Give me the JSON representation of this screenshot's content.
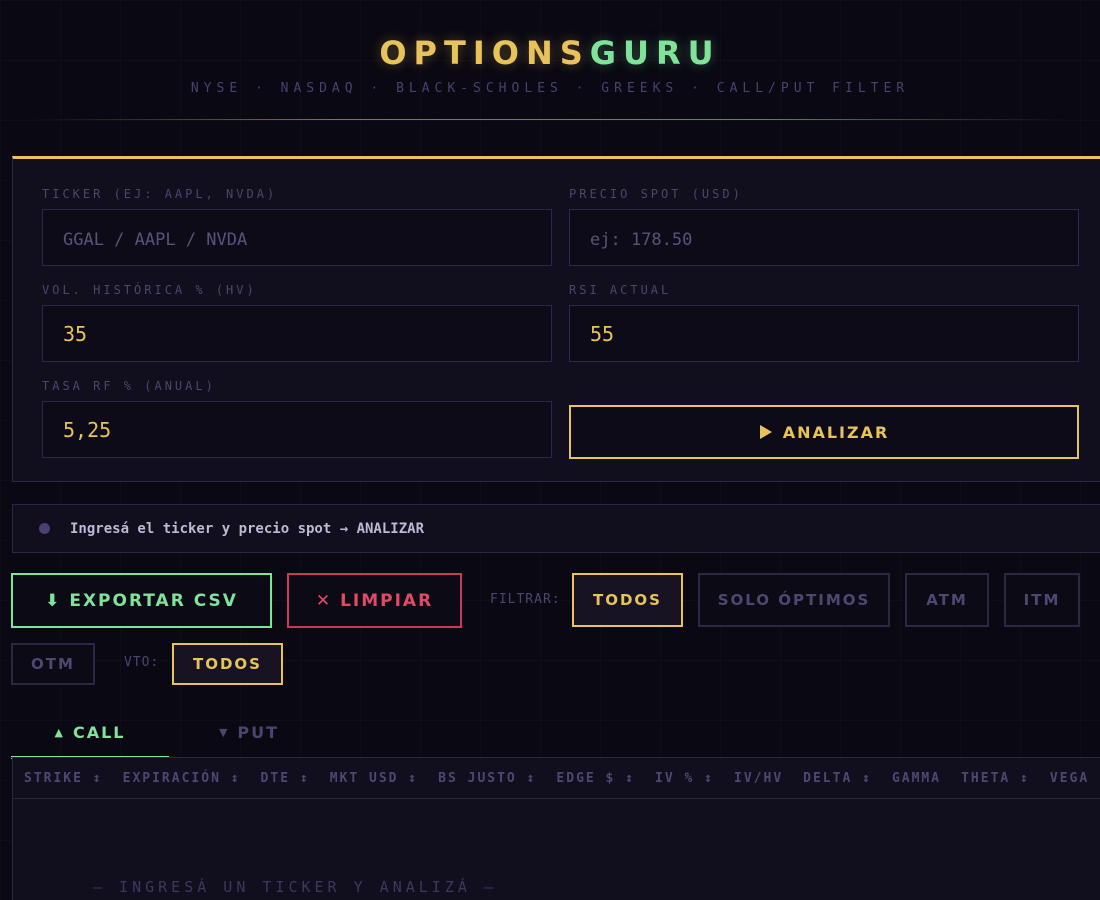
{
  "header": {
    "logo_part1": "OPTIONS",
    "logo_part2": "GURU",
    "subtitle": "NYSE · NASDAQ · BLACK-SCHOLES · GREEKS · CALL/PUT FILTER"
  },
  "form": {
    "ticker": {
      "label": "TICKER (EJ: AAPL, NVDA)",
      "placeholder": "GGAL / AAPL / NVDA",
      "value": ""
    },
    "spot": {
      "label": "PRECIO SPOT (USD)",
      "placeholder": "ej: 178.50",
      "value": ""
    },
    "hv": {
      "label": "VOL. HISTÓRICA % (HV)",
      "value": "35"
    },
    "rsi": {
      "label": "RSI ACTUAL",
      "value": "55"
    },
    "rate": {
      "label": "TASA RF % (ANUAL)",
      "value": "5,25"
    },
    "analyze_label": "ANALIZAR"
  },
  "status": {
    "text": "Ingresá el ticker y precio spot → ANALIZAR"
  },
  "actions": {
    "export_label": "EXPORTAR CSV",
    "clear_label": "LIMPIAR"
  },
  "filters": {
    "filter_label": "FILTRAR:",
    "options": [
      "TODOS",
      "SOLO ÓPTIMOS",
      "ATM",
      "ITM",
      "OTM"
    ],
    "selected": "TODOS",
    "expiry_label": "VTO:",
    "expiry_selected": "TODOS"
  },
  "tabs": {
    "call": "CALL",
    "put": "PUT",
    "active": "call"
  },
  "table": {
    "columns": [
      "STRIKE ↕",
      "EXPIRACIÓN ↕",
      "DTE ↕",
      "MKT USD ↕",
      "BS JUSTO ↕",
      "EDGE $ ↕",
      "IV % ↕",
      "IV/HV",
      "DELTA ↕",
      "GAMMA",
      "THETA ↕",
      "VEGA"
    ],
    "empty_text": "— INGRESÁ UN TICKER Y ANALIZÁ —"
  },
  "colors": {
    "accent_gold": "#e8c35a",
    "accent_green": "#7fe39a",
    "danger": "#e04a66",
    "background": "#0a0812"
  },
  "icons": {
    "export": "download-arrow-icon",
    "clear": "x-icon",
    "analyze": "play-icon",
    "call_tab": "triangle-up-icon",
    "put_tab": "triangle-down-icon",
    "status": "status-dot-icon"
  }
}
